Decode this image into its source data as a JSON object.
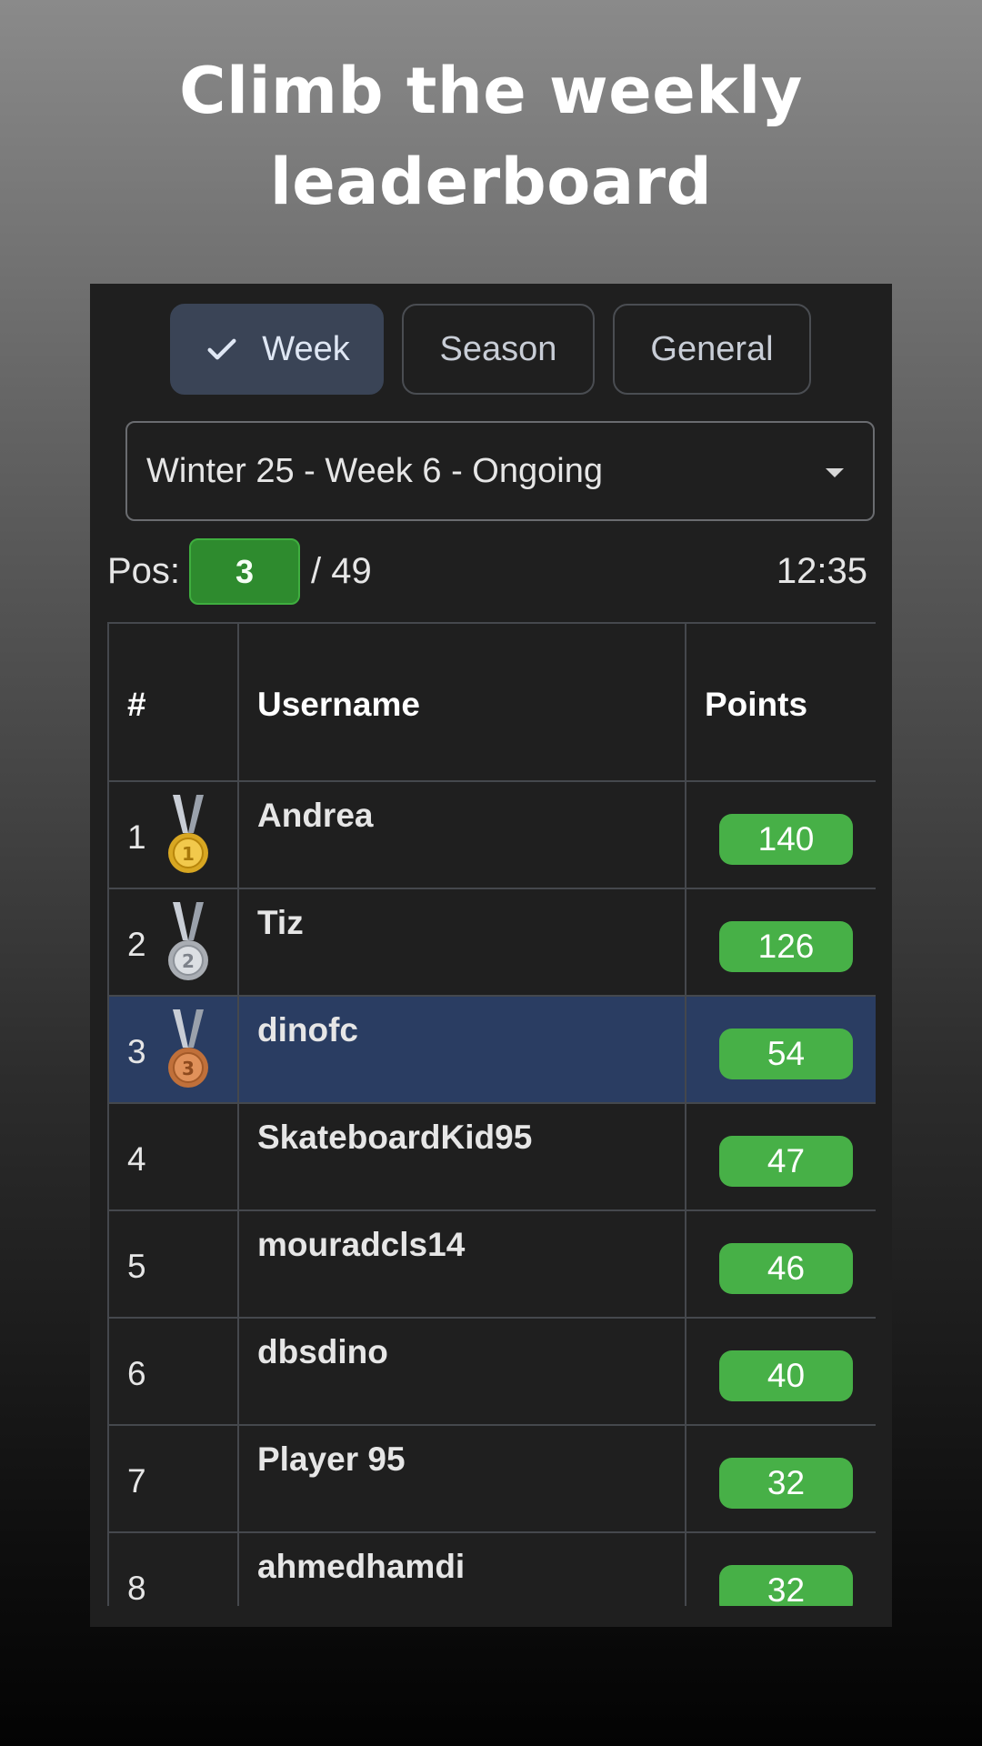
{
  "hero": {
    "line1": "Climb the weekly",
    "line2": "leaderboard"
  },
  "tabs": [
    {
      "label": "Week",
      "active": true
    },
    {
      "label": "Season",
      "active": false
    },
    {
      "label": "General",
      "active": false
    }
  ],
  "period_select": {
    "value": "Winter 25 - Week 6 - Ongoing",
    "icon": "dropdown-caret-icon"
  },
  "position": {
    "label": "Pos:",
    "value": "3",
    "total": "/ 49"
  },
  "time": "12:35",
  "table": {
    "headers": {
      "rank": "#",
      "username": "Username",
      "points": "Points"
    },
    "rows": [
      {
        "rank": "1",
        "username": "Andrea",
        "points": "140",
        "medal": "gold-medal-icon"
      },
      {
        "rank": "2",
        "username": "Tiz",
        "points": "126",
        "medal": "silver-medal-icon"
      },
      {
        "rank": "3",
        "username": "dinofc",
        "points": "54",
        "medal": "bronze-medal-icon",
        "highlighted": true
      },
      {
        "rank": "4",
        "username": "SkateboardKid95",
        "points": "47"
      },
      {
        "rank": "5",
        "username": "mouradcls14",
        "points": "46"
      },
      {
        "rank": "6",
        "username": "dbsdino",
        "points": "40"
      },
      {
        "rank": "7",
        "username": "Player 95",
        "points": "32"
      },
      {
        "rank": "8",
        "username": "ahmedhamdi",
        "points": "32"
      }
    ]
  },
  "colors": {
    "active_tab": "#3a4456",
    "highlight_row": "#2a3d62",
    "points_badge": "#47b047",
    "position_badge": "#2e8b2e",
    "panel": "#1f1f1f"
  }
}
